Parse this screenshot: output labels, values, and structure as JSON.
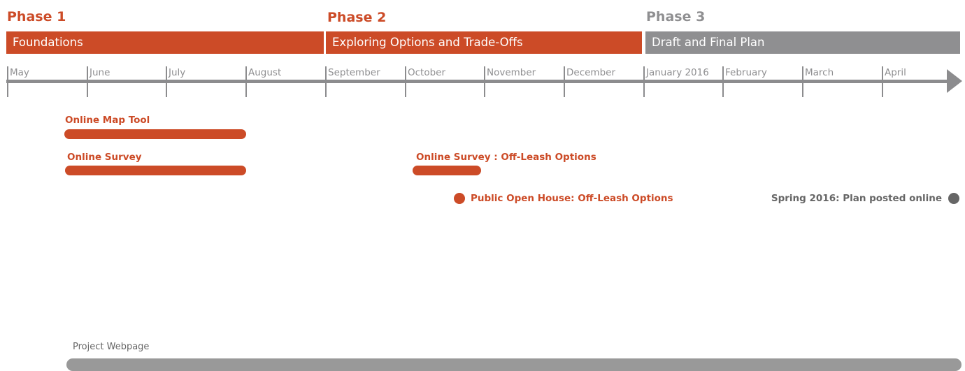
{
  "colors": {
    "accent": "#cc4b27",
    "muted": "#8f8f91",
    "milestone_gray": "#666666",
    "bar_gray": "#999999"
  },
  "phases": [
    {
      "title": "Phase 1",
      "bar_label": "Foundations"
    },
    {
      "title": "Phase 2",
      "bar_label": "Exploring Options and Trade-Offs"
    },
    {
      "title": "Phase 3",
      "bar_label": "Draft and Final Plan"
    }
  ],
  "timeline": {
    "months": [
      "May",
      "June",
      "July",
      "August",
      "September",
      "October",
      "November",
      "December",
      "January 2016",
      "February",
      "March",
      "April"
    ]
  },
  "activities": [
    {
      "label": "Online Map Tool"
    },
    {
      "label": "Online Survey"
    },
    {
      "label": "Online Survey : Off-Leash Options"
    }
  ],
  "milestones": [
    {
      "label": "Public Open House: Off-Leash Options"
    },
    {
      "label": "Spring 2016: Plan posted online"
    }
  ],
  "webpage": {
    "label": "Project Webpage"
  }
}
